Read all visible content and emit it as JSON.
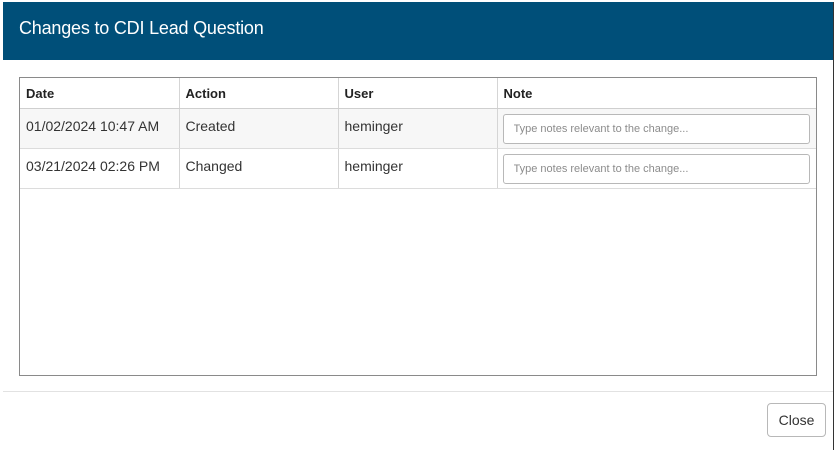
{
  "dialog": {
    "title": "Changes to CDI Lead Question"
  },
  "table": {
    "columns": [
      "Date",
      "Action",
      "User",
      "Note"
    ],
    "rows": [
      {
        "date": "01/02/2024 10:47 AM",
        "action": "Created",
        "user": "heminger",
        "note": "",
        "note_placeholder": "Type notes relevant to the change..."
      },
      {
        "date": "03/21/2024 02:26 PM",
        "action": "Changed",
        "user": "heminger",
        "note": "",
        "note_placeholder": "Type notes relevant to the change..."
      }
    ]
  },
  "footer": {
    "close_label": "Close"
  },
  "colors": {
    "header_bg": "#004f79",
    "header_text": "#ffffff"
  }
}
